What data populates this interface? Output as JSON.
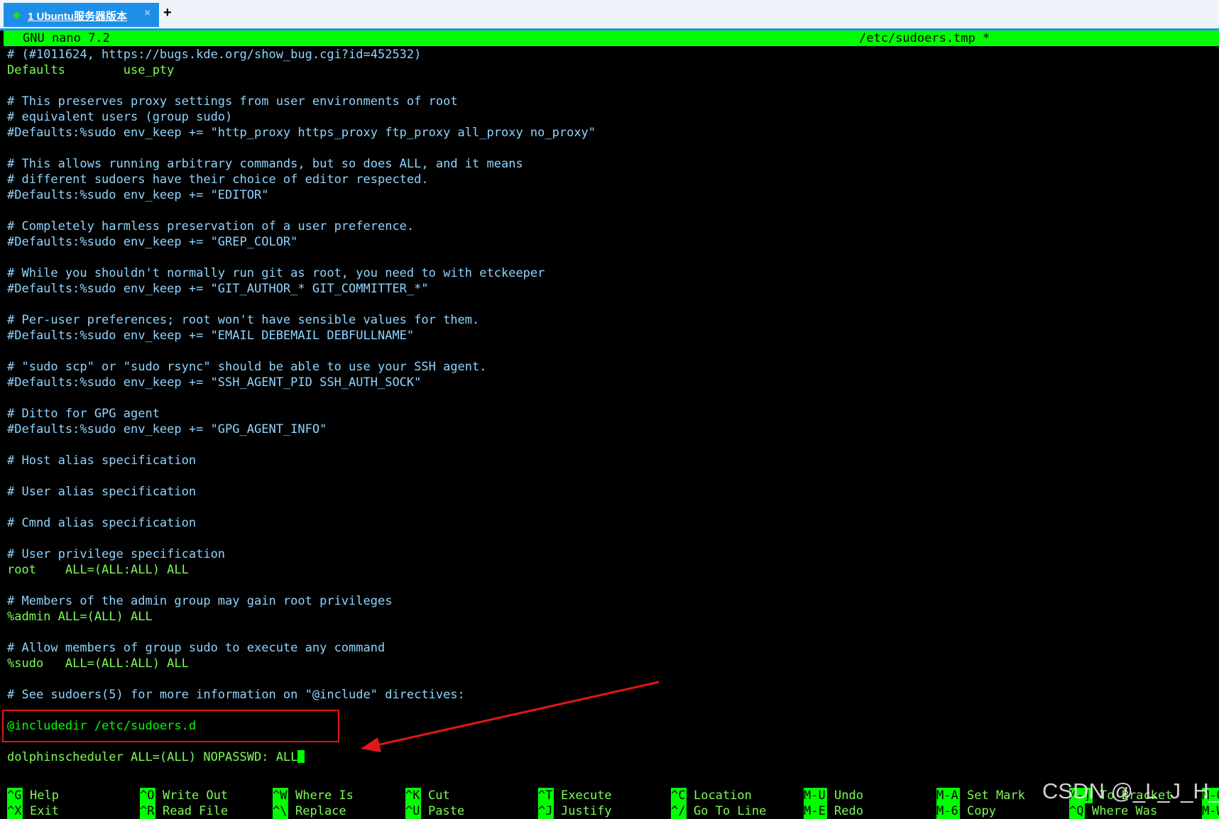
{
  "tab": {
    "label": "1 Ubuntu服务器版本",
    "close": "×",
    "add": "+"
  },
  "editor": {
    "app_name": "GNU nano 7.2",
    "file_name": "/etc/sudoers.tmp *"
  },
  "lines": [
    "# (#1011624, https://bugs.kde.org/show_bug.cgi?id=452532)",
    "Defaults        use_pty",
    "",
    "# This preserves proxy settings from user environments of root",
    "# equivalent users (group sudo)",
    "#Defaults:%sudo env_keep += \"http_proxy https_proxy ftp_proxy all_proxy no_proxy\"",
    "",
    "# This allows running arbitrary commands, but so does ALL, and it means",
    "# different sudoers have their choice of editor respected.",
    "#Defaults:%sudo env_keep += \"EDITOR\"",
    "",
    "# Completely harmless preservation of a user preference.",
    "#Defaults:%sudo env_keep += \"GREP_COLOR\"",
    "",
    "# While you shouldn't normally run git as root, you need to with etckeeper",
    "#Defaults:%sudo env_keep += \"GIT_AUTHOR_* GIT_COMMITTER_*\"",
    "",
    "# Per-user preferences; root won't have sensible values for them.",
    "#Defaults:%sudo env_keep += \"EMAIL DEBEMAIL DEBFULLNAME\"",
    "",
    "# \"sudo scp\" or \"sudo rsync\" should be able to use your SSH agent.",
    "#Defaults:%sudo env_keep += \"SSH_AGENT_PID SSH_AUTH_SOCK\"",
    "",
    "# Ditto for GPG agent",
    "#Defaults:%sudo env_keep += \"GPG_AGENT_INFO\"",
    "",
    "# Host alias specification",
    "",
    "# User alias specification",
    "",
    "# Cmnd alias specification",
    "",
    "# User privilege specification",
    "root    ALL=(ALL:ALL) ALL",
    "",
    "# Members of the admin group may gain root privileges",
    "%admin ALL=(ALL) ALL",
    "",
    "# Allow members of group sudo to execute any command",
    "%sudo   ALL=(ALL:ALL) ALL",
    "",
    "# See sudoers(5) for more information on \"@include\" directives:",
    "",
    "@includedir /etc/sudoers.d",
    "",
    "dolphinscheduler ALL=(ALL) NOPASSWD: ALL"
  ],
  "shortcuts": [
    [
      {
        "key": "^G",
        "label": "Help"
      },
      {
        "key": "^X",
        "label": "Exit"
      }
    ],
    [
      {
        "key": "^O",
        "label": "Write Out"
      },
      {
        "key": "^R",
        "label": "Read File"
      }
    ],
    [
      {
        "key": "^W",
        "label": "Where Is"
      },
      {
        "key": "^\\",
        "label": "Replace"
      }
    ],
    [
      {
        "key": "^K",
        "label": "Cut"
      },
      {
        "key": "^U",
        "label": "Paste"
      }
    ],
    [
      {
        "key": "^T",
        "label": "Execute"
      },
      {
        "key": "^J",
        "label": "Justify"
      }
    ],
    [
      {
        "key": "^C",
        "label": "Location"
      },
      {
        "key": "^/",
        "label": "Go To Line"
      }
    ],
    [
      {
        "key": "M-U",
        "label": "Undo"
      },
      {
        "key": "M-E",
        "label": "Redo"
      }
    ],
    [
      {
        "key": "M-A",
        "label": "Set Mark"
      },
      {
        "key": "M-6",
        "label": "Copy"
      }
    ],
    [
      {
        "key": "M-]",
        "label": "To Bracket"
      },
      {
        "key": "^Q",
        "label": "Where Was"
      }
    ],
    [
      {
        "key": "M-Q",
        "label": ""
      },
      {
        "key": "M-W",
        "label": ""
      }
    ]
  ],
  "watermark": "CSDN @_L_J_H_",
  "colors": {
    "terminal_bg": "#000000",
    "titlebar_bg": "#00ff00",
    "comment_text": "#8fd4ff",
    "code_text": "#7dfc55",
    "highlight_box": "#e01818",
    "tab_bg": "#1e8fe6"
  }
}
